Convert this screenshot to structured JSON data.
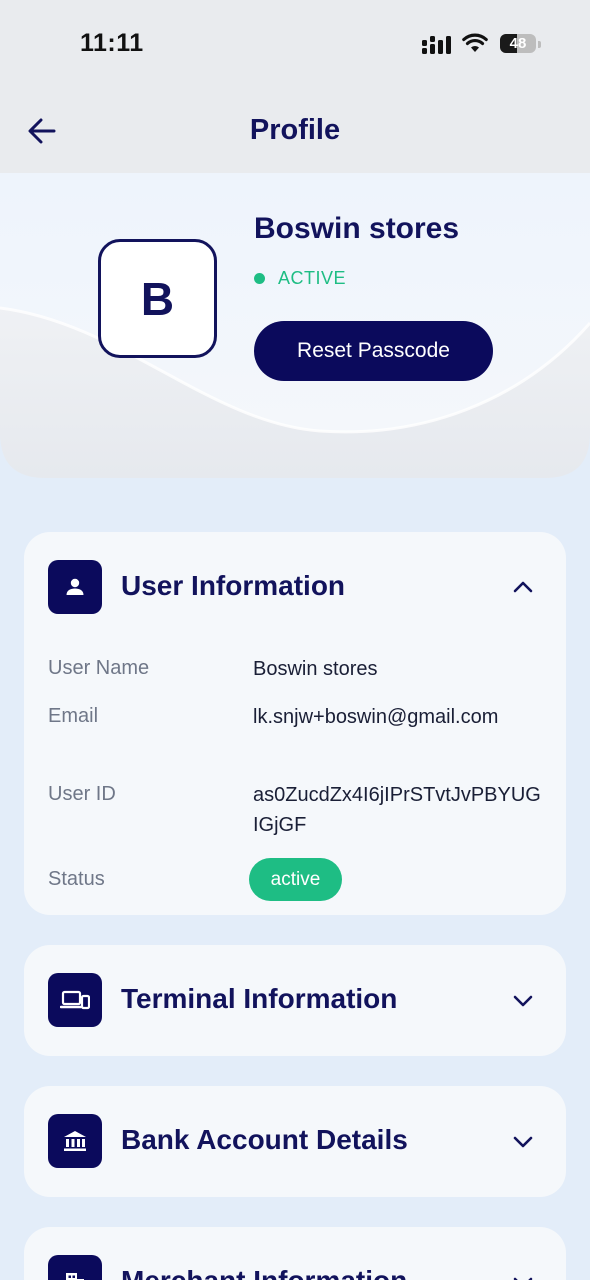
{
  "status_bar": {
    "time": "11:11",
    "battery": "48",
    "battery_level": 0.48
  },
  "header": {
    "title": "Profile",
    "back_icon": "arrow-left-icon"
  },
  "profile": {
    "avatar_letter": "B",
    "name": "Boswin stores",
    "status": "ACTIVE",
    "reset_button": "Reset Passcode"
  },
  "colors": {
    "primary": "#0b0a5c",
    "active": "#1ebd84",
    "background": "#e3edf9"
  },
  "sections": {
    "user_info": {
      "title": "User Information",
      "icon": "person-icon",
      "expanded": true,
      "fields": [
        {
          "label": "User Name",
          "value": "Boswin stores"
        },
        {
          "label": "Email",
          "value": "lk.snjw+boswin@gmail.com"
        },
        {
          "label": "User ID",
          "value": "as0ZucdZx4I6jIPrSTvtJvPBYUGIGjGF"
        },
        {
          "label": "Status",
          "value": "active"
        }
      ]
    },
    "terminal": {
      "title": "Terminal Information",
      "icon": "devices-icon",
      "expanded": false
    },
    "bank": {
      "title": "Bank Account Details",
      "icon": "bank-icon",
      "expanded": false
    },
    "merchant": {
      "title": "Merchant Information",
      "icon": "building-icon",
      "expanded": false
    }
  }
}
